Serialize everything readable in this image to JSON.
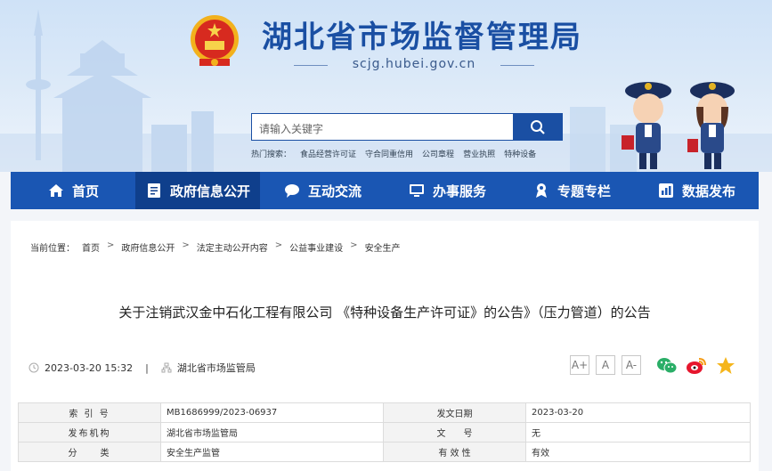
{
  "site": {
    "title": "湖北省市场监督管理局",
    "domain": "scjg.hubei.gov.cn"
  },
  "search": {
    "placeholder": "请输入关键字",
    "hot_label": "热门搜索：",
    "hot_words": [
      "食品经营许可证",
      "守合同重信用",
      "公司章程",
      "营业执照",
      "特种设备"
    ]
  },
  "nav": [
    {
      "label": "首页",
      "icon": "home-icon"
    },
    {
      "label": "政府信息公开",
      "icon": "document-icon",
      "active": true
    },
    {
      "label": "互动交流",
      "icon": "chat-icon"
    },
    {
      "label": "办事服务",
      "icon": "monitor-icon"
    },
    {
      "label": "专题专栏",
      "icon": "badge-icon"
    },
    {
      "label": "数据发布",
      "icon": "bar-chart-icon"
    }
  ],
  "breadcrumb": {
    "label": "当前位置：",
    "items": [
      "首页",
      "政府信息公开",
      "法定主动公开内容",
      "公益事业建设",
      "安全生产"
    ]
  },
  "article": {
    "title": "关于注销武汉金中石化工程有限公司 《特种设备生产许可证》的公告》（压力管道）的公告",
    "datetime": "2023-03-20 15:32",
    "source": "湖北省市场监管局"
  },
  "font_buttons": [
    "A+",
    "A",
    "A-"
  ],
  "share": [
    "wechat-icon",
    "weibo-icon",
    "favorite-star-icon"
  ],
  "info_table": {
    "rows": [
      {
        "l1": "索 引 号",
        "v1": "MB1686999/2023-06937",
        "l2": "发文日期",
        "v2": "2023-03-20"
      },
      {
        "l1": "发布机构",
        "v1": "湖北省市场监管局",
        "l2": "文　　号",
        "v2": "无"
      },
      {
        "l1": "分　　类",
        "v1": "安全生产监管",
        "l2": "有 效 性",
        "v2": "有效"
      }
    ]
  },
  "colors": {
    "brand_blue": "#1a56b3",
    "nav_active": "#0f3f8c",
    "title_blue": "#1a4fa3"
  }
}
